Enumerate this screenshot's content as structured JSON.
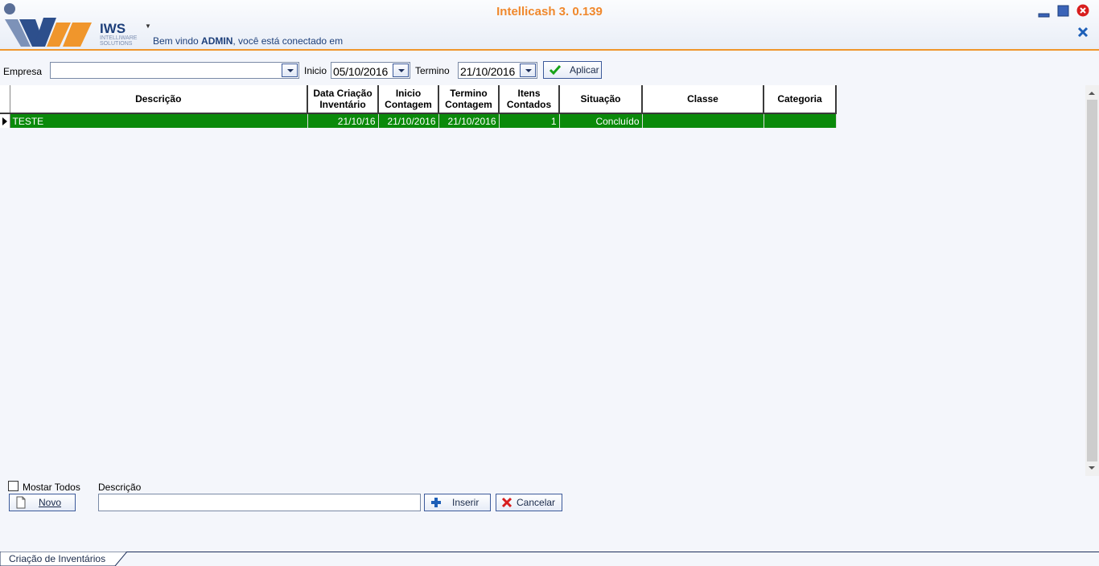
{
  "app": {
    "title": "Intellicash 3. 0.139",
    "logo_text": "IWS",
    "logo_sub1": "INTELLIWARE",
    "logo_sub2": "SOLUTIONS",
    "welcome_prefix": "Bem vindo ",
    "welcome_user": "ADMIN",
    "welcome_suffix": ", você está conectado em"
  },
  "filters": {
    "empresa_label": "Empresa",
    "empresa_value": "",
    "inicio_label": "Inicio",
    "inicio_value": "05/10/2016",
    "termino_label": "Termino",
    "termino_value": "21/10/2016",
    "apply_label": "Aplicar"
  },
  "grid": {
    "columns": [
      "Descrição",
      "Data Criação Inventário",
      "Inicio Contagem",
      "Termino Contagem",
      "Itens Contados",
      "Situação",
      "Classe",
      "Categoria"
    ],
    "rows": [
      {
        "descricao": "TESTE",
        "data_criacao": "21/10/16",
        "inicio": "21/10/2016",
        "termino": "21/10/2016",
        "itens": "1",
        "situacao": "Concluído",
        "classe": "",
        "categoria": ""
      }
    ]
  },
  "form": {
    "mostrar_todos_label": "Mostar Todos",
    "mostrar_todos_checked": false,
    "novo_label": "Novo",
    "descricao_label": "Descrição",
    "descricao_value": "",
    "inserir_label": "Inserir",
    "cancelar_label": "Cancelar"
  },
  "tabs": [
    {
      "label": "Criação de Inventários"
    }
  ],
  "colors": {
    "accent": "#f0882c",
    "selected_row": "#0a8a0a",
    "brand": "#1d3f7a"
  }
}
